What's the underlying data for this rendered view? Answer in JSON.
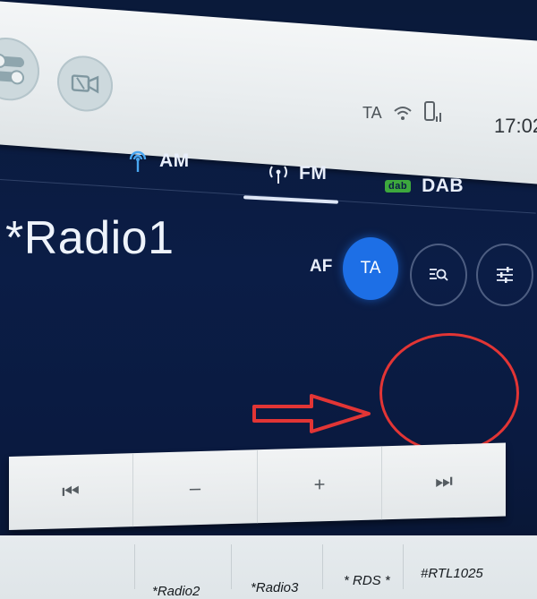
{
  "status_bar": {
    "ta_indicator": "TA",
    "clock": "17:02"
  },
  "tabs": [
    {
      "label": "AM",
      "icon": "antenna-icon"
    },
    {
      "label": "FM",
      "icon": "broadcast-icon",
      "selected": true
    },
    {
      "label": "DAB",
      "icon": "dab-logo-icon",
      "logo_text": "dab"
    }
  ],
  "station": {
    "name": "*Radio1"
  },
  "options": {
    "af_label": "AF",
    "ta_label": "TA",
    "ta_active": true
  },
  "controls": {
    "prev": "⏮",
    "minus": "–",
    "plus": "+",
    "next": "⏭"
  },
  "presets": [
    "*Radio2",
    "*Radio3",
    "* RDS *",
    "#RTL1025"
  ],
  "colors": {
    "accent_blue": "#1d6fe6",
    "annotation_red": "#e23535",
    "screen_bg": "#0b1d46"
  }
}
